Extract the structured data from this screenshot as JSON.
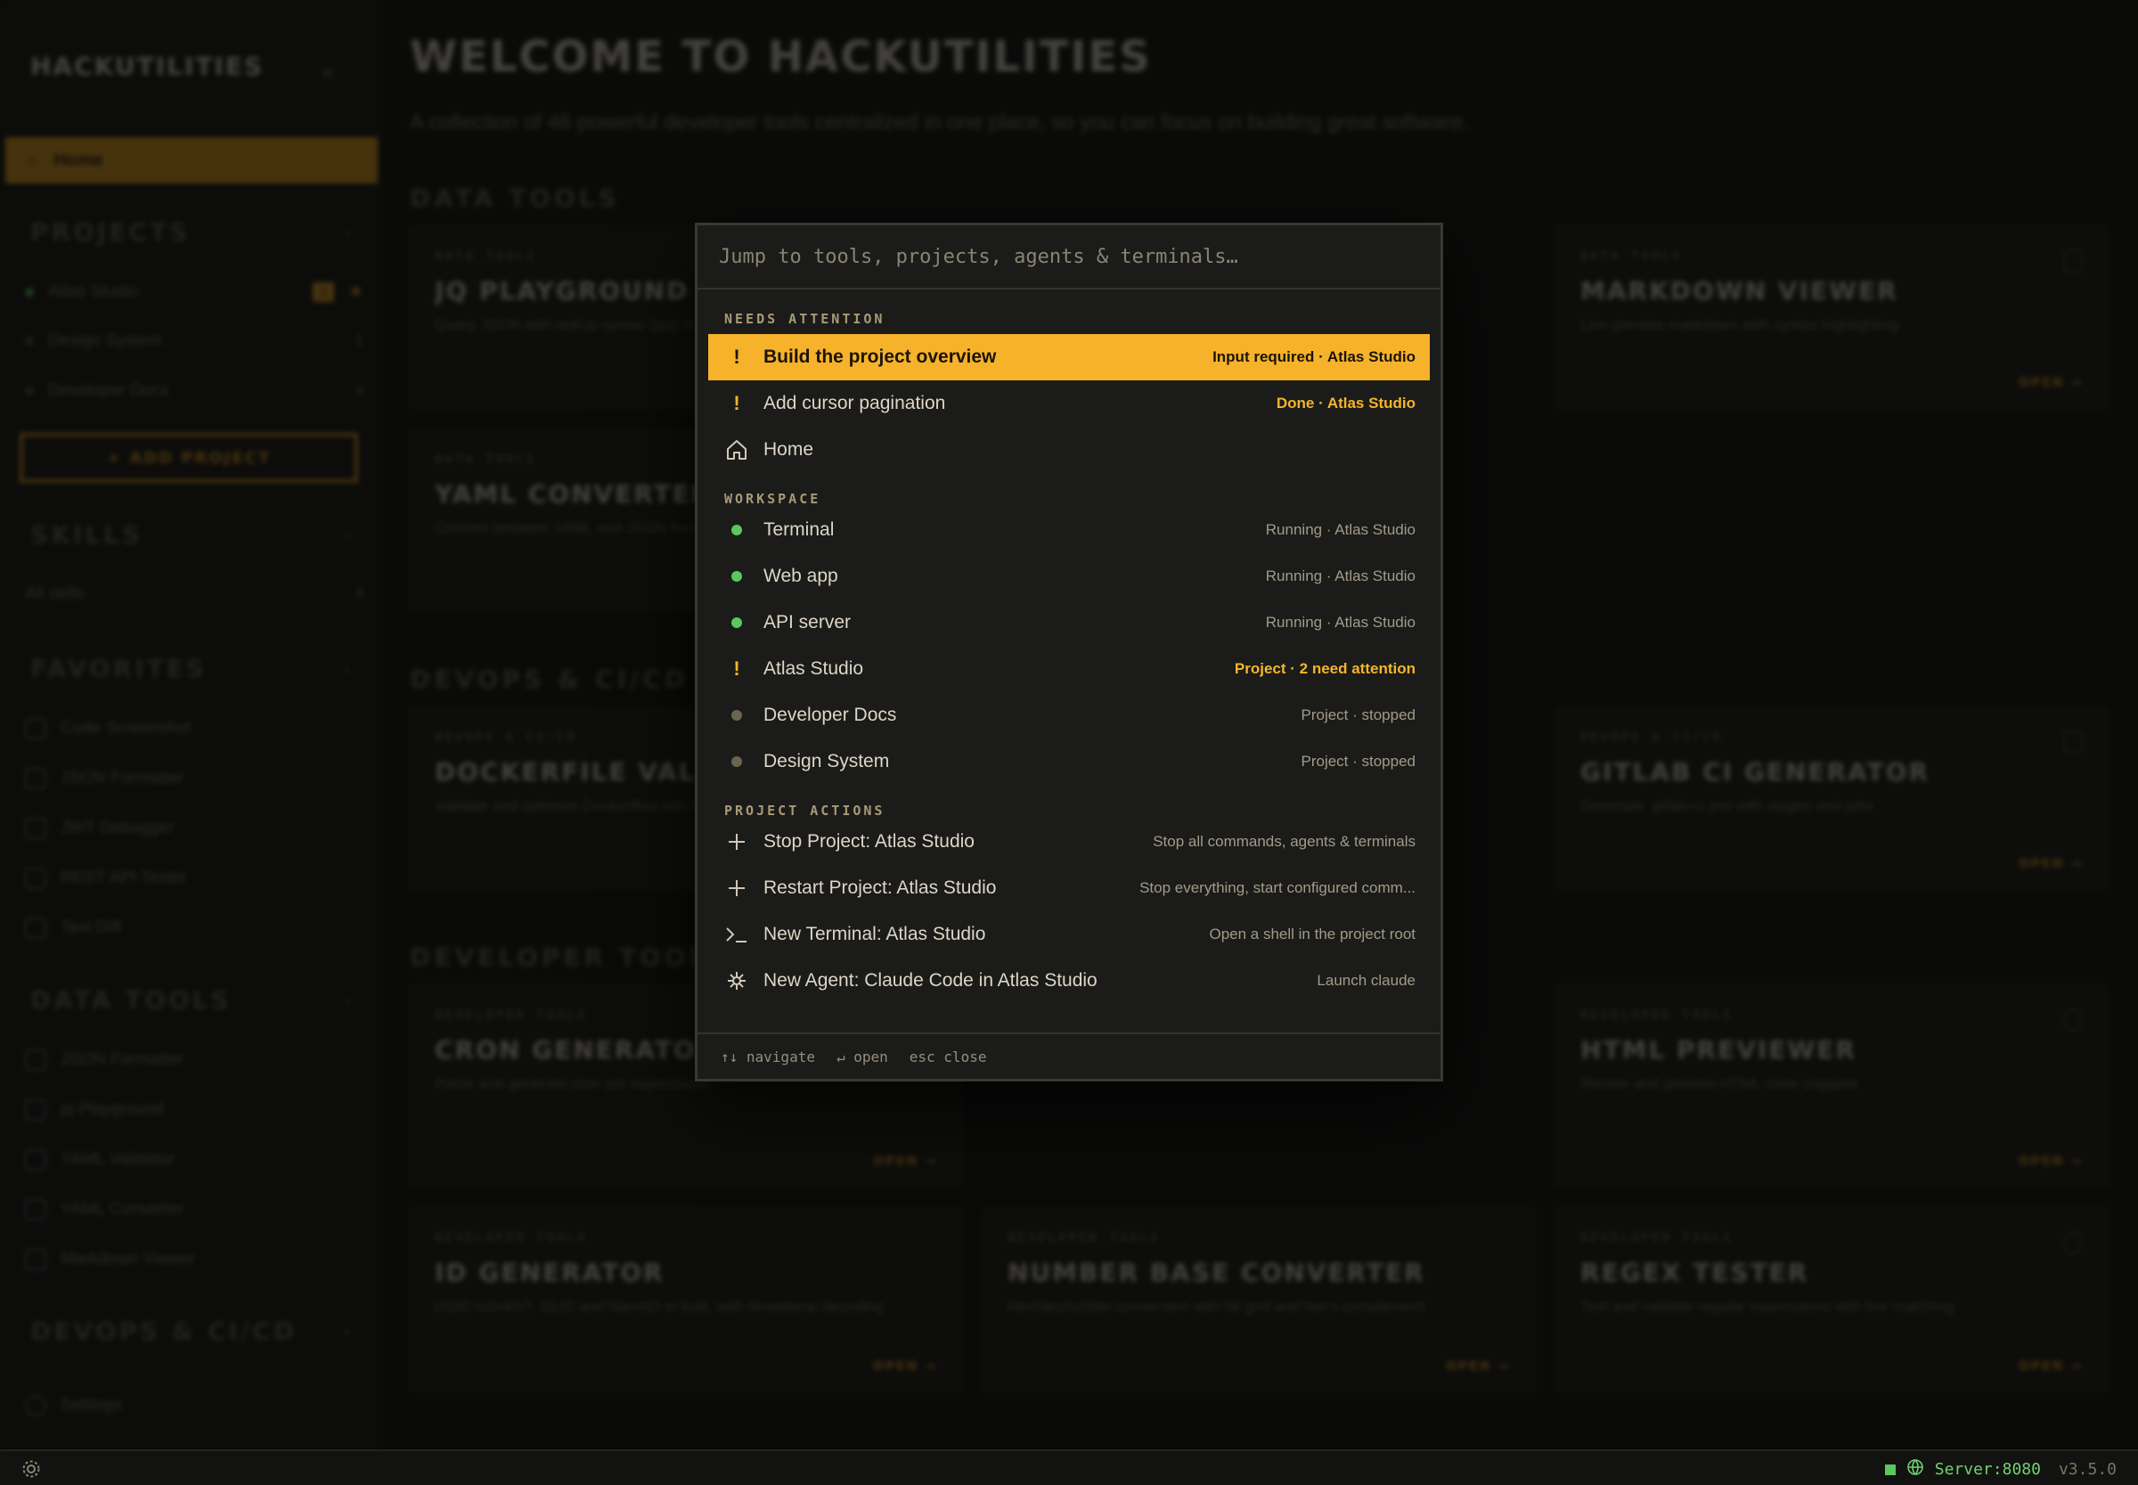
{
  "sidebar": {
    "brand": "HACKUTILITIES",
    "home": "Home",
    "sections": {
      "projects": "PROJECTS",
      "skills": "SKILLS",
      "favorites": "FAVORITES",
      "data_tools": "DATA TOOLS",
      "devops": "DEVOPS & CI/CD"
    },
    "projects": [
      {
        "name": "Atlas Studio",
        "badge": "2"
      },
      {
        "name": "Design System",
        "count": "1"
      },
      {
        "name": "Developer Docs",
        "count": "4"
      }
    ],
    "add_project": "+ ADD PROJECT",
    "skills_all": "All skills",
    "skills_count": "9",
    "favorites": [
      "Code Screenshot",
      "JSON Formatter",
      "JWT Debugger",
      "REST API Tester",
      "Text Diff"
    ],
    "data_tools": [
      "JSON Formatter",
      "jq Playground",
      "YAML Validator",
      "YAML Converter",
      "Markdown Viewer"
    ],
    "settings": "Settings"
  },
  "main": {
    "title": "WELCOME TO HACKUTILITIES",
    "subtitle": "A collection of 46 powerful developer tools centralized in one place, so you can focus on building great software.",
    "sections": {
      "data": "DATA TOOLS",
      "devops": "DEVOPS & CI/CD",
      "dev": "DEVELOPER TOOLS"
    },
    "open_label": "OPEN →",
    "cards": {
      "jq": {
        "cat": "DATA TOOLS",
        "name": "JQ PLAYGROUND",
        "desc": "Query JSON with real jq syntax (jaq) in your browser"
      },
      "md": {
        "cat": "DATA TOOLS",
        "name": "MARKDOWN VIEWER",
        "desc": "Live preview markdown with syntax highlighting"
      },
      "yaml": {
        "cat": "DATA TOOLS",
        "name": "YAML CONVERTER",
        "desc": "Convert between YAML and JSON formats"
      },
      "docker": {
        "cat": "DEVOPS & CI/CD",
        "name": "DOCKERFILE VALIDATOR",
        "desc": "Validate and optimize Dockerfiles with best practices"
      },
      "gitlab": {
        "cat": "DEVOPS & CI/CD",
        "name": "GITLAB CI GENERATOR",
        "desc": "Generate .gitlab-ci.yml with stages and jobs"
      },
      "cron": {
        "cat": "DEVELOPER TOOLS",
        "name": "CRON GENERATOR",
        "desc": "Parse and generate cron job expressions"
      },
      "html": {
        "cat": "DEVELOPER TOOLS",
        "name": "HTML PREVIEWER",
        "desc": "Render and preview HTML code snippets"
      },
      "id": {
        "cat": "DEVELOPER TOOLS",
        "name": "ID GENERATOR",
        "desc": "UUID v1/v4/v7, ULID and NanoID in bulk, with timestamp decoding"
      },
      "base": {
        "cat": "DEVELOPER TOOLS",
        "name": "NUMBER BASE CONVERTER",
        "desc": "Hex/dec/oct/bin conversion with bit grid and two's complement"
      },
      "regex": {
        "cat": "DEVELOPER TOOLS",
        "name": "REGEX TESTER",
        "desc": "Test and validate regular expressions with live matching"
      }
    }
  },
  "palette": {
    "search_placeholder": "Jump to tools, projects, agents & terminals…",
    "groups": {
      "attention": "NEEDS ATTENTION",
      "workspace": "WORKSPACE",
      "actions": "PROJECT ACTIONS"
    },
    "attention": [
      {
        "label": "Build the project overview",
        "meta": "Input required · Atlas Studio"
      },
      {
        "label": "Add cursor pagination",
        "meta": "Done · Atlas Studio"
      },
      {
        "label": "Home",
        "meta": ""
      }
    ],
    "workspace": [
      {
        "label": "Terminal",
        "meta": "Running · Atlas Studio"
      },
      {
        "label": "Web app",
        "meta": "Running · Atlas Studio"
      },
      {
        "label": "API server",
        "meta": "Running · Atlas Studio"
      },
      {
        "label": "Atlas Studio",
        "meta": "Project · 2 need attention"
      },
      {
        "label": "Developer Docs",
        "meta": "Project · stopped"
      },
      {
        "label": "Design System",
        "meta": "Project · stopped"
      }
    ],
    "actions": [
      {
        "label": "Stop Project: Atlas Studio",
        "meta": "Stop all commands, agents & terminals"
      },
      {
        "label": "Restart Project: Atlas Studio",
        "meta": "Stop everything, start configured comm..."
      },
      {
        "label": "New Terminal: Atlas Studio",
        "meta": "Open a shell in the project root"
      },
      {
        "label": "New Agent: Claude Code in Atlas Studio",
        "meta": "Launch claude"
      }
    ],
    "footer": {
      "navigate": "↑↓ navigate",
      "open": "↵ open",
      "close": "esc close"
    }
  },
  "statusbar": {
    "server": "Server:8080",
    "version": "v3.5.0"
  },
  "colors": {
    "accent": "#f7b22b",
    "running": "#5ac85a",
    "background": "#0d0d0c"
  }
}
